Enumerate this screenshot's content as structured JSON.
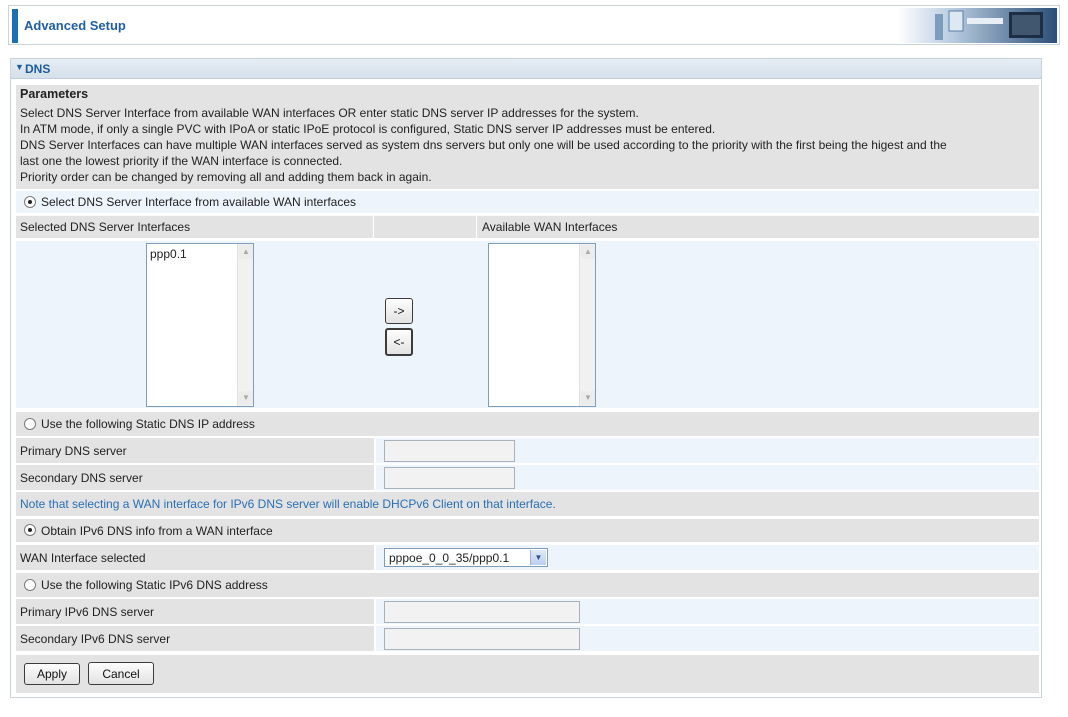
{
  "header": {
    "title": "Advanced Setup"
  },
  "panel": {
    "title": "DNS"
  },
  "parameters": {
    "heading": "Parameters",
    "lines": [
      "Select DNS Server Interface from available WAN interfaces OR enter static DNS server IP addresses for the system.",
      "In ATM mode, if only a single PVC with IPoA or static IPoE protocol is configured, Static DNS server IP addresses must be entered.",
      "DNS Server Interfaces can have multiple WAN interfaces served as system dns servers but only one will be used according to the priority with the first being the higest and the",
      "last one the lowest priority if the WAN interface is connected.",
      "Priority order can be changed by removing all and adding them back in again."
    ]
  },
  "interface_mode": {
    "option_label": "Select DNS Server Interface from available WAN interfaces",
    "selected": true,
    "selected_col_header": "Selected DNS Server Interfaces",
    "available_col_header": "Available WAN Interfaces",
    "selected_items": [
      "ppp0.1"
    ],
    "available_items": [],
    "move_right_label": "->",
    "move_left_label": "<-"
  },
  "static_dns": {
    "option_label": "Use the following Static DNS IP address",
    "selected": false,
    "primary_label": "Primary DNS server",
    "primary_value": "",
    "secondary_label": "Secondary DNS server",
    "secondary_value": ""
  },
  "ipv6": {
    "note": "Note that selecting a WAN interface for IPv6 DNS server will enable DHCPv6 Client on that interface.",
    "obtain_option_label": "Obtain IPv6 DNS info from a WAN interface",
    "obtain_selected": true,
    "wan_interface_label": "WAN Interface selected",
    "wan_interface_value": "pppoe_0_0_35/ppp0.1",
    "static_option_label": "Use the following Static IPv6 DNS address",
    "static_selected": false,
    "primary_label": "Primary IPv6 DNS server",
    "primary_value": "",
    "secondary_label": "Secondary IPv6 DNS server",
    "secondary_value": ""
  },
  "actions": {
    "apply_label": "Apply",
    "cancel_label": "Cancel"
  },
  "icons": {
    "collapse": "triangle-down-icon",
    "banner": "computer-network-banner",
    "scroll_up": "scroll-up-arrow-icon",
    "scroll_down": "scroll-down-arrow-icon",
    "dropdown": "chevron-down-icon"
  },
  "colors": {
    "accent": "#1c6fb3",
    "title": "#1f5fa6",
    "note": "#2a6fb5",
    "row_gray": "#e3e3e3",
    "row_blue": "#eef4fb"
  }
}
